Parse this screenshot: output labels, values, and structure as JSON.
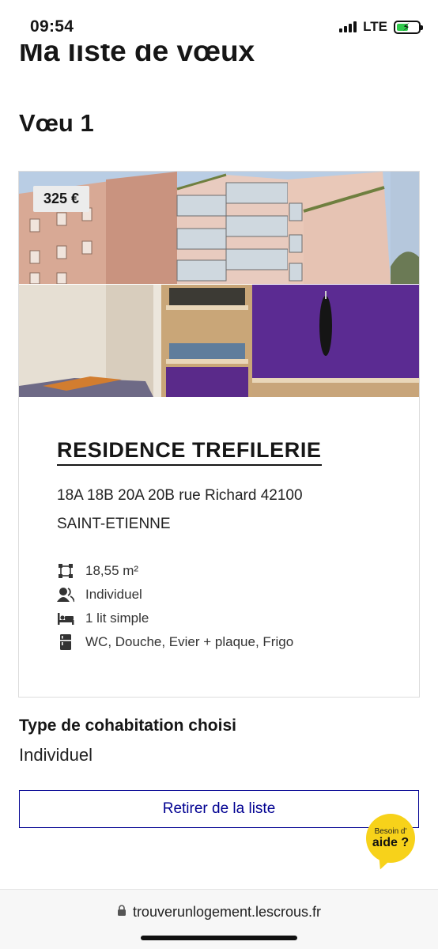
{
  "status_bar": {
    "time": "09:54",
    "network": "LTE",
    "battery_charging": true
  },
  "page": {
    "heading": "Ma liste de vœux",
    "wish_title": "Vœu 1"
  },
  "card": {
    "price": "325 €",
    "residence_name": "RESIDENCE TREFILERIE",
    "address_line1": "18A 18B 20A 20B rue Richard 42100",
    "address_line2": "SAINT-ETIENNE",
    "features": [
      {
        "icon": "area-icon",
        "text": "18,55 m²"
      },
      {
        "icon": "person-icon",
        "text": "Individuel"
      },
      {
        "icon": "bed-icon",
        "text": "1 lit simple"
      },
      {
        "icon": "fridge-icon",
        "text": "WC, Douche, Evier + plaque, Frigo"
      }
    ]
  },
  "cohabitation": {
    "label": "Type de cohabitation choisi",
    "value": "Individuel"
  },
  "actions": {
    "remove_label": "Retirer de la liste"
  },
  "help": {
    "small": "Besoin d'",
    "big": "aide ?"
  },
  "browser": {
    "url": "trouverunlogement.lescrous.fr"
  },
  "colors": {
    "primary_blue": "#000091",
    "help_yellow": "#f7d21a"
  }
}
